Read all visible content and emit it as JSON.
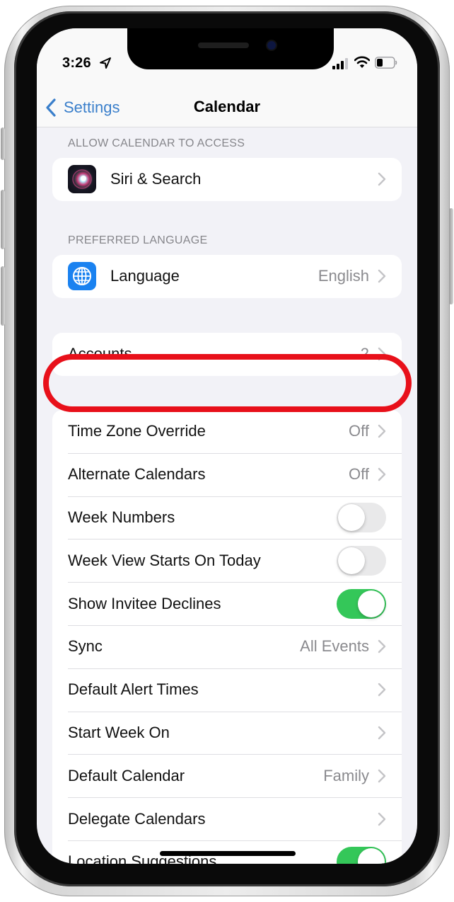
{
  "status_bar": {
    "time": "3:26",
    "icons": [
      "location-arrow-icon",
      "cellular-signal-icon",
      "wifi-icon",
      "battery-icon"
    ]
  },
  "nav": {
    "back_label": "Settings",
    "title": "Calendar"
  },
  "sections": {
    "access": {
      "header": "ALLOW CALENDAR TO ACCESS",
      "rows": [
        {
          "label": "Siri & Search",
          "icon": "siri-icon"
        }
      ]
    },
    "language": {
      "header": "PREFERRED LANGUAGE",
      "rows": [
        {
          "label": "Language",
          "value": "English",
          "icon": "globe-icon"
        }
      ]
    },
    "accounts": {
      "rows": [
        {
          "label": "Accounts",
          "value": "2"
        }
      ]
    },
    "settings": {
      "rows": [
        {
          "label": "Time Zone Override",
          "value": "Off",
          "type": "disclosure"
        },
        {
          "label": "Alternate Calendars",
          "value": "Off",
          "type": "disclosure"
        },
        {
          "label": "Week Numbers",
          "type": "toggle",
          "on": false
        },
        {
          "label": "Week View Starts On Today",
          "type": "toggle",
          "on": false
        },
        {
          "label": "Show Invitee Declines",
          "type": "toggle",
          "on": true
        },
        {
          "label": "Sync",
          "value": "All Events",
          "type": "disclosure"
        },
        {
          "label": "Default Alert Times",
          "type": "disclosure"
        },
        {
          "label": "Start Week On",
          "type": "disclosure"
        },
        {
          "label": "Default Calendar",
          "value": "Family",
          "type": "disclosure"
        },
        {
          "label": "Delegate Calendars",
          "type": "disclosure"
        },
        {
          "label": "Location Suggestions",
          "type": "toggle",
          "on": true
        }
      ]
    }
  },
  "colors": {
    "accent": "#3a7fcb",
    "toggle_on": "#34c759",
    "toggle_off": "#e9e9ea",
    "highlight": "#e8101a",
    "background": "#f2f2f7"
  }
}
